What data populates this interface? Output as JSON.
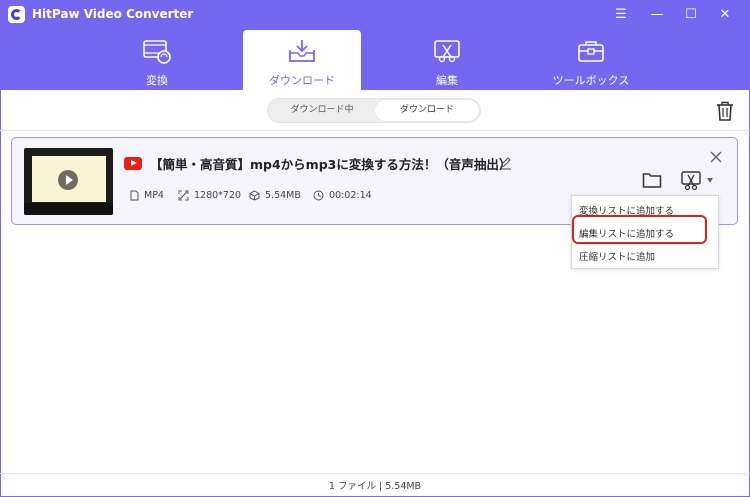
{
  "app": {
    "title": "HitPaw Video Converter"
  },
  "window_controls": {
    "menu": "☰",
    "minimize": "—",
    "maximize": "☐",
    "close": "✕"
  },
  "nav": {
    "tabs": [
      {
        "label": "変換",
        "icon": "film-convert-icon"
      },
      {
        "label": "ダウンロード",
        "icon": "download-tray-icon",
        "active": true
      },
      {
        "label": "編集",
        "icon": "edit-scissor-icon"
      },
      {
        "label": "ツールボックス",
        "icon": "toolbox-icon"
      }
    ]
  },
  "segments": {
    "downloading": "ダウンロード中",
    "downloaded": "ダウンロード",
    "active": "downloaded"
  },
  "item": {
    "source_icon": "youtube-icon",
    "title": "【簡単・高音質】mp4からmp3に変換する方法！（音声抽出）",
    "format": "MP4",
    "resolution": "1280*720",
    "size": "5.54MB",
    "duration": "00:02:14"
  },
  "dropdown": {
    "items": [
      "変換リストに追加する",
      "編集リストに追加する",
      "圧縮リストに追加"
    ],
    "highlighted_index": 1
  },
  "status_bar": {
    "text": "1 ファイル | 5.54MB"
  },
  "colors": {
    "accent": "#7467f0",
    "highlight_border": "#d4261b",
    "youtube_red": "#e62117"
  }
}
